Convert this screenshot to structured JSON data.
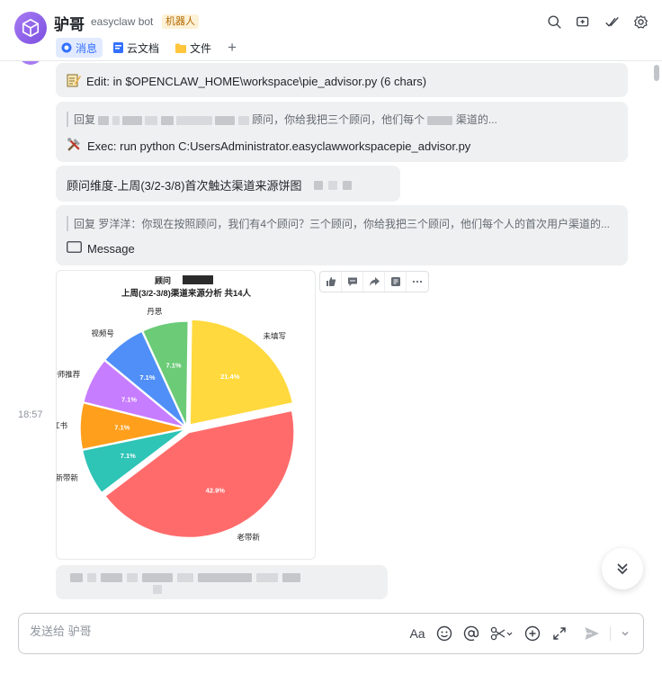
{
  "header": {
    "name": "驴哥",
    "subtitle": "easyclaw bot",
    "badge": "机器人",
    "tabs": [
      {
        "label": "消息",
        "icon": "message-icon",
        "active": true
      },
      {
        "label": "云文档",
        "icon": "doc-icon",
        "active": false
      },
      {
        "label": "文件",
        "icon": "folder-icon",
        "active": false
      }
    ],
    "add_tab": "+",
    "icons": [
      "search-icon",
      "add-chat-icon",
      "check-icon",
      "settings-icon"
    ]
  },
  "messages": {
    "edit_line": "Edit: in $OPENCLAW_HOME\\workspace\\pie_advisor.py (6 chars)",
    "reply1_quote_prefix": "回复",
    "reply1_quote_mid": "顾问，你给我把三个顾问，他们每个",
    "reply1_quote_tail": "渠道的...",
    "exec_line": "Exec: run python C:UsersAdministrator.easyclawworkspacepie_advisor.py",
    "title_line": "顾问维度-上周(3/2-3/8)首次触达渠道来源饼图",
    "reply2_quote": "回复 罗洋洋：你现在按照顾问，我们有4个顾问？三个顾问，你给我把三个顾问，他们每个人的首次用户渠道的...",
    "message_label": "Message",
    "time": "18:57"
  },
  "chart_data": {
    "type": "pie",
    "title_line1": "顾问",
    "title_line2": "上周(3/2-3/8)渠道来源分析  共14人",
    "slices": [
      {
        "label": "老师推荐",
        "value": 7.1,
        "value_label": "7.1%",
        "color": "#c77dff"
      },
      {
        "label": "视频号",
        "value": 7.1,
        "value_label": "7.1%",
        "color": "#4f8ff7"
      },
      {
        "label": "丹思",
        "value": 7.1,
        "value_label": "7.1%",
        "color": "#6bcb77"
      },
      {
        "label": "未填写",
        "value": 21.4,
        "value_label": "21.4%",
        "color": "#ffd93d"
      },
      {
        "label": "老带新",
        "value": 42.9,
        "value_label": "42.9%",
        "color": "#ff6b6b"
      },
      {
        "label": "新带新",
        "value": 7.1,
        "value_label": "7.1%",
        "color": "#2ec4b6"
      },
      {
        "label": "小红书",
        "value": 7.1,
        "value_label": "7.1%",
        "color": "#ff9f1c"
      }
    ]
  },
  "composer": {
    "placeholder": "发送给 驴哥",
    "font_tool": "Aa",
    "tools": [
      "font-icon",
      "emoji-icon",
      "mention-icon",
      "scissors-icon",
      "plus-circle-icon",
      "expand-icon",
      "send-icon",
      "chevron-down-icon"
    ]
  }
}
